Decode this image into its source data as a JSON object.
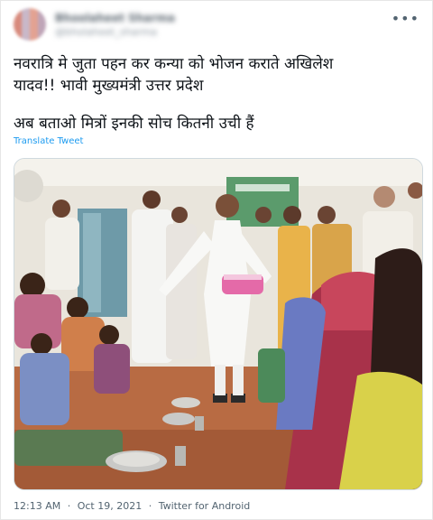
{
  "tweet": {
    "author_name": "Bhoolaheet Sharma",
    "author_handle": "@bholaheet_sharma",
    "more_icon": "more-horizontal-icon",
    "text_line1": "नवरात्रि मे जुता पहन कर कन्या को भोजन कराते अखिलेश\nयादव!! भावी मुख्यमंत्री उत्तर प्रदेश",
    "text_line2": "अब बताओ मित्रों इनकी सोच कितनी उची हैं",
    "translate_label": "Translate Tweet",
    "time": "12:13 AM",
    "separator": "·",
    "date": "Oct 19, 2021",
    "source": "Twitter for Android"
  },
  "colors": {
    "link": "#1d9bf0",
    "text": "#0f1419",
    "muted": "#536471"
  }
}
